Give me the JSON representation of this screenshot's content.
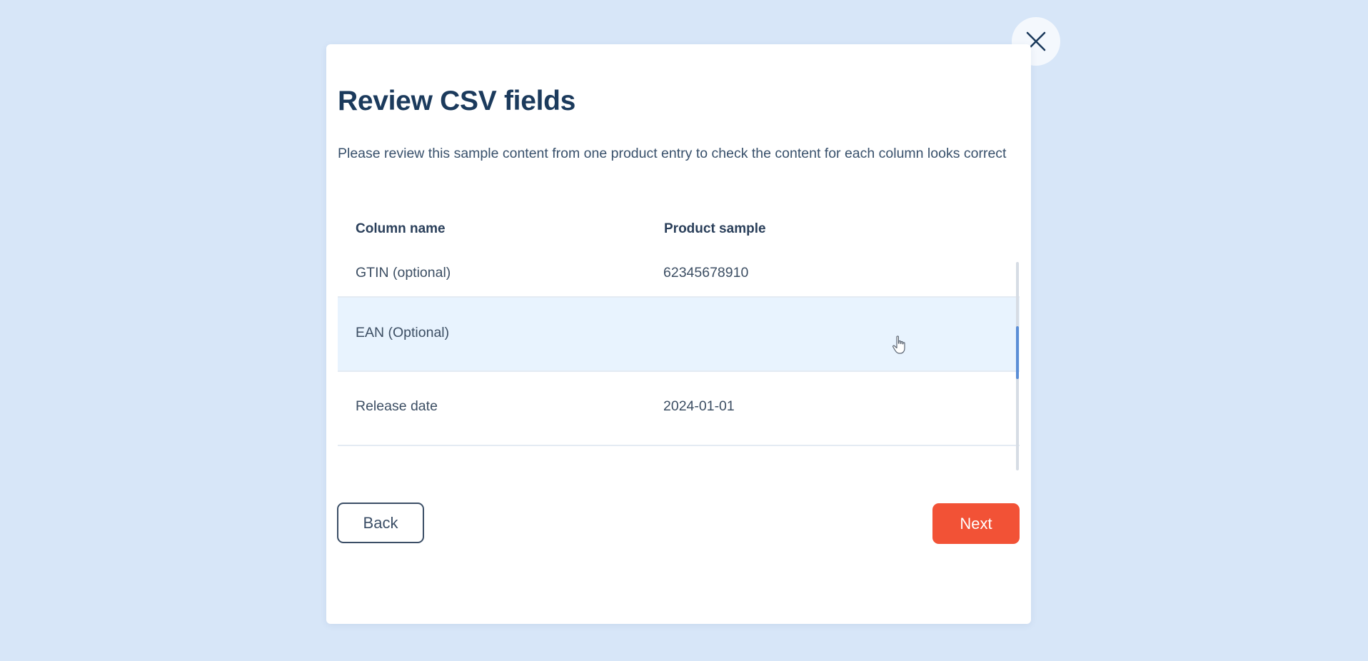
{
  "modal": {
    "title": "Review CSV fields",
    "subtitle": "Please review this sample content from one product entry to check the content for each column looks correct"
  },
  "table": {
    "headers": {
      "column_name": "Column name",
      "product_sample": "Product sample"
    },
    "rows": [
      {
        "column_name": "GTIN (optional)",
        "product_sample": "62345678910"
      },
      {
        "column_name": "EAN (Optional)",
        "product_sample": ""
      },
      {
        "column_name": "Release date",
        "product_sample": "2024-01-01"
      }
    ]
  },
  "actions": {
    "back_label": "Back",
    "next_label": "Next"
  },
  "icons": {
    "close": "close-icon",
    "cursor": "hand-pointer-icon"
  },
  "colors": {
    "background": "#d7e6f8",
    "title": "#1b3a5c",
    "next_button": "#f25236",
    "row_highlight": "#e8f3fe",
    "scroll_thumb": "#5b8ed6"
  }
}
